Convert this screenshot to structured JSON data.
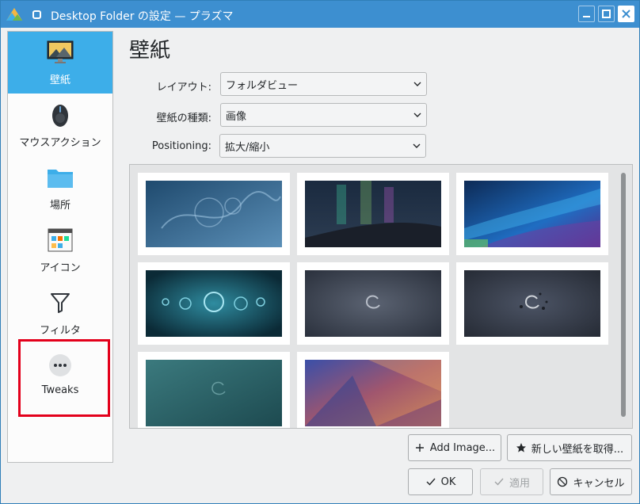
{
  "window": {
    "title": "Desktop Folder の設定 — プラズマ"
  },
  "sidebar": {
    "items": [
      {
        "label": "壁紙",
        "icon": "wallpaper-icon",
        "active": true
      },
      {
        "label": "マウスアクション",
        "icon": "mouse-icon",
        "active": false
      },
      {
        "label": "場所",
        "icon": "folder-icon",
        "active": false
      },
      {
        "label": "アイコン",
        "icon": "icon-view-icon",
        "active": false
      },
      {
        "label": "フィルタ",
        "icon": "filter-icon",
        "active": false
      },
      {
        "label": "Tweaks",
        "icon": "more-icon",
        "active": false
      }
    ]
  },
  "main": {
    "title": "壁紙",
    "layout": {
      "label": "レイアウト:",
      "value": "フォルダビュー"
    },
    "wallpaper_type": {
      "label": "壁紙の種類:",
      "value": "画像"
    },
    "positioning": {
      "label": "Positioning:",
      "value": "拡大/縮小"
    },
    "wallpapers": [
      {
        "name": "blue-swirls"
      },
      {
        "name": "aurora-night"
      },
      {
        "name": "blue-waves"
      },
      {
        "name": "teal-bokeh"
      },
      {
        "name": "debian-swirl-gray"
      },
      {
        "name": "debian-swirl-particles"
      },
      {
        "name": "teal-debian-swirl"
      },
      {
        "name": "purple-geometric"
      }
    ]
  },
  "buttons": {
    "add_image": "Add Image...",
    "get_new": "新しい壁紙を取得...",
    "ok": "OK",
    "apply": "適用",
    "cancel": "キャンセル"
  },
  "colors": {
    "accent": "#3daee9",
    "titlebar": "#3d8fd0",
    "highlight": "#e3001b"
  }
}
